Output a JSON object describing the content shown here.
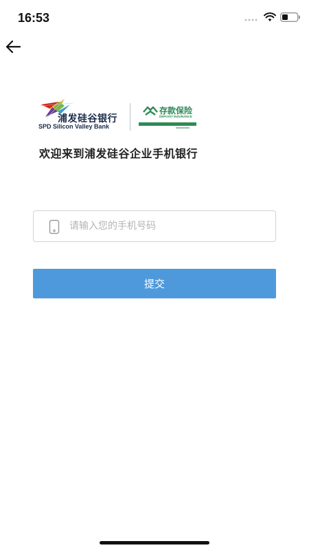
{
  "status_bar": {
    "time": "16:53",
    "icons": [
      "cellular-signal-icon",
      "wifi-icon",
      "battery-icon"
    ]
  },
  "nav": {
    "back_icon": "arrow-left-icon"
  },
  "logos": {
    "bank_cn_name": "浦发硅谷银行",
    "bank_en_name": "SPD Silicon Valley Bank",
    "deposit_cn": "存款保险",
    "deposit_en": "DEPOSIT INSURANCE"
  },
  "welcome": {
    "text": "欢迎来到浦发硅谷企业手机银行"
  },
  "form": {
    "phone_icon": "mobile-phone-icon",
    "phone_placeholder": "请输入您的手机号码",
    "phone_value": "",
    "submit_label": "提交"
  },
  "colors": {
    "primary_button": "#4e99dc",
    "deposit_green": "#2e8a55",
    "bank_navy": "#1a2b4a"
  }
}
